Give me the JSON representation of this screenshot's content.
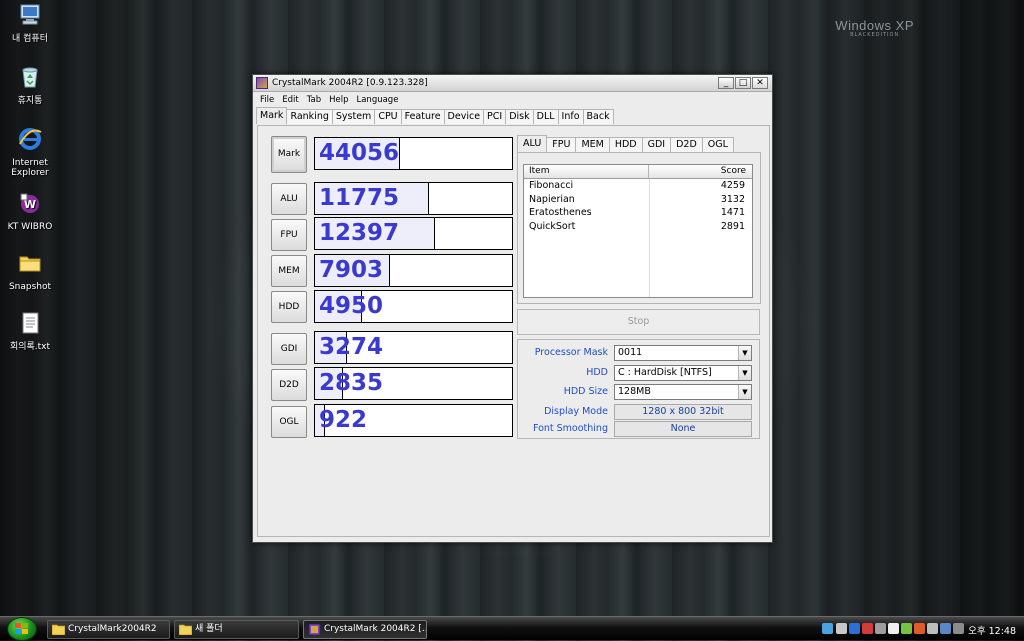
{
  "desktop": {
    "os_logo_line1": "Windows XP",
    "os_logo_line2": "BLACKEDITION",
    "icons": [
      {
        "label": "내 컴퓨터",
        "icon": "computer-icon"
      },
      {
        "label": "휴지통",
        "icon": "recycle-bin-icon"
      },
      {
        "label": "Internet Explorer",
        "icon": "internet-explorer-icon"
      },
      {
        "label": "KT WIBRO",
        "icon": "wibro-icon"
      },
      {
        "label": "Snapshot",
        "icon": "folder-icon"
      },
      {
        "label": "회의록.txt",
        "icon": "text-file-icon"
      }
    ]
  },
  "window": {
    "title": "CrystalMark 2004R2 [0.9.123.328]",
    "controls": {
      "minimize": "_",
      "maximize": "□",
      "close": "✕"
    },
    "menu": [
      "File",
      "Edit",
      "Tab",
      "Help",
      "Language"
    ],
    "tabs": [
      "Mark",
      "Ranking",
      "System",
      "CPU",
      "Feature",
      "Device",
      "PCI",
      "Disk",
      "DLL",
      "Info",
      "Back"
    ],
    "active_tab": "Mark"
  },
  "benchmarks": [
    {
      "label": "Mark",
      "score": "44056",
      "fill": 0.43
    },
    {
      "label": "ALU",
      "score": "11775",
      "fill": 0.58
    },
    {
      "label": "FPU",
      "score": "12397",
      "fill": 0.61
    },
    {
      "label": "MEM",
      "score": "7903",
      "fill": 0.38
    },
    {
      "label": "HDD",
      "score": "4950",
      "fill": 0.24
    },
    {
      "label": "GDI",
      "score": "3274",
      "fill": 0.16
    },
    {
      "label": "D2D",
      "score": "2835",
      "fill": 0.14
    },
    {
      "label": "OGL",
      "score": "922",
      "fill": 0.05
    }
  ],
  "detail": {
    "tabs": [
      "ALU",
      "FPU",
      "MEM",
      "HDD",
      "GDI",
      "D2D",
      "OGL"
    ],
    "active_tab": "ALU",
    "columns": [
      "Item",
      "Score"
    ],
    "rows": [
      {
        "item": "Fibonacci",
        "score": "4259"
      },
      {
        "item": "Napierian",
        "score": "3132"
      },
      {
        "item": "Eratosthenes",
        "score": "1471"
      },
      {
        "item": "QuickSort",
        "score": "2891"
      }
    ]
  },
  "stop_label": "Stop",
  "settings": {
    "processor_mask_label": "Processor Mask",
    "processor_mask_value": "0011",
    "hdd_label": "HDD",
    "hdd_value": "C : HardDisk [NTFS]",
    "hdd_size_label": "HDD Size",
    "hdd_size_value": "128MB",
    "display_mode_label": "Display Mode",
    "display_mode_value": "1280 x 800 32bit",
    "font_smoothing_label": "Font Smoothing",
    "font_smoothing_value": "None"
  },
  "taskbar": {
    "buttons": [
      {
        "label": "CrystalMark2004R2",
        "icon": "folder-icon"
      },
      {
        "label": "새 폴더",
        "icon": "folder-icon"
      },
      {
        "label": "CrystalMark 2004R2 [...",
        "icon": "crystalmark-icon"
      }
    ],
    "clock": "오후 12:48"
  },
  "colors": {
    "score_text": "#3a3ad0",
    "bar_fill": "#eeeefb",
    "settings_label": "#1f4ec9"
  }
}
